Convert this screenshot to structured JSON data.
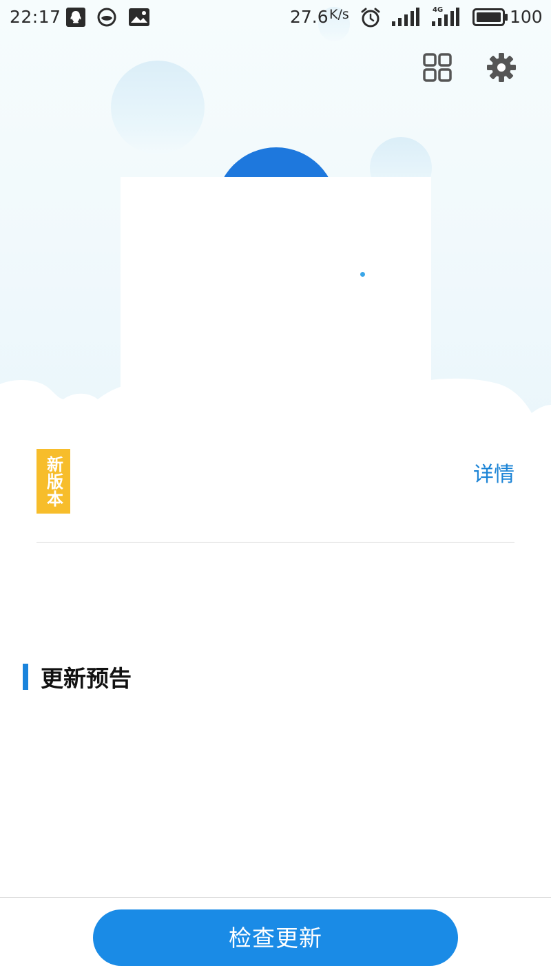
{
  "status_bar": {
    "time": "22:17",
    "net_speed": "27.6",
    "net_speed_unit": "K/s",
    "network_type": "4G",
    "battery": "100",
    "icons": [
      "qq-icon",
      "browser-icon",
      "gallery-icon",
      "alarm-icon",
      "signal-icon",
      "signal-4g-icon",
      "battery-icon"
    ]
  },
  "toolbar": {
    "icons": [
      "grid-icon",
      "settings-gear-icon"
    ]
  },
  "version": {
    "badge": "新版本",
    "details_label": "详情"
  },
  "section": {
    "title": "更新预告"
  },
  "footer": {
    "check_button": "检查更新"
  },
  "colors": {
    "primary": "#1a8be6",
    "badge": "#f7bd2b",
    "link": "#1c84d6",
    "dome": "#1e78dd"
  }
}
